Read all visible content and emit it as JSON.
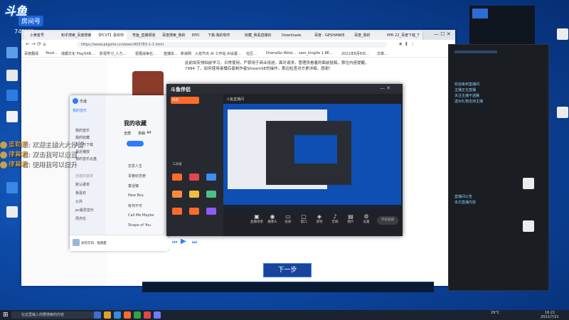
{
  "streamer": {
    "logo_text": "斗鱼",
    "room_label": "房间号",
    "room_number": "74????"
  },
  "chat_overlay": [
    {
      "name": "鉴勒葱",
      "message": "欢迎主播大大停留"
    },
    {
      "name": "律幕君",
      "message": "双击我可以设置"
    },
    {
      "name": "律幕君",
      "message": "使用我可以提升"
    }
  ],
  "browser": {
    "tabs": [
      "小黄金号",
      "知乎搜索_百度搜索",
      "【PCVT】喜欢你",
      "粤鱼_直播频道",
      "百度搜索_我的",
      "EPIC",
      "",
      "",
      "下载-我的软件",
      "收藏_我看直播的",
      "Downloads",
      "百度 - GESHANKE",
      "百度_我的",
      "PPR 22_百度下载_T"
    ],
    "url": "https://www.pkgsite.cn/down/405783-1-1.html",
    "bookmarks": [
      "百度翻译",
      "Youd…",
      "成都文化 PlaySXB…",
      "影视学习_人力…",
      "雷霆战争社…",
      "直播车…",
      "新浪网",
      "火焰节点",
      "AI 工作站 AI设置…",
      "仓库网站",
      "仓库更新…",
      "社区…",
      "DramaSo Wold…",
      "sam_kingtle 1.8E…",
      "2021年6月8日…",
      "百度…",
      "文章…"
    ],
    "article_lines": [
      "此前如安排拍前学习，日常使用，严禁用于商业用途。面对请求，管理员看着的面前投稿，那位内容提醒，",
      "7994 了，如何使用录播后者制作者StreamSE的操作，那边检查对方更详细，感谢！"
    ]
  },
  "music": {
    "user": "乐迷",
    "side_title": "我的音乐",
    "side_items": [
      "我的音乐",
      "我的收藏",
      "本地与下载",
      "最近播放",
      "我的音乐云盘",
      "喜欢的",
      "看过的"
    ],
    "playlists_title": "创建的歌单",
    "playlists": [
      "默认歌单",
      "我喜欢",
      "公共",
      "pc最爱音乐",
      "周杰伦"
    ],
    "main_title": "我的收藏",
    "tabs": [
      "全部",
      "单曲",
      "专辑",
      "歌单"
    ],
    "count": "44",
    "rows": [
      "恋爱人生",
      "青春纪念册",
      "童话镇",
      "New Boy",
      "有何不可",
      "Call Me Maybe",
      "Shape of You"
    ],
    "now_playing": "光的方向 · 张碧晨"
  },
  "recorder": {
    "title": "斗鱼伴侣",
    "sidebar_items": [
      "场景",
      "工具箱",
      "主播",
      "美颜",
      "特效",
      "弹幕",
      "连麦",
      "录制"
    ],
    "preview_title": "斗鱼直播间",
    "controls": [
      "直播场景",
      "摄像头",
      "投屏",
      "窗口",
      "游戏",
      "音频",
      "图片",
      "设置"
    ],
    "start_button": "开始直播"
  },
  "right_panel": {
    "chat_lines": [
      "欢迎来到直播间",
      "主播正在直播",
      "关注主播不迷路",
      "送出礼物支持主播",
      "直播间公告",
      "本次直播内容",
      "欢迎新进房的观众",
      "一起聊天互动"
    ]
  },
  "next_button": "下一步",
  "taskbar": {
    "search_placeholder": "在这里输入你要搜索的内容",
    "temperature": "29°C",
    "time": "16:21",
    "date": "2021/7/21"
  },
  "colors": {
    "wallpaper": "#0d4aa8",
    "accent": "#1d65d8",
    "recorder_accent": "#ff6a2b"
  }
}
